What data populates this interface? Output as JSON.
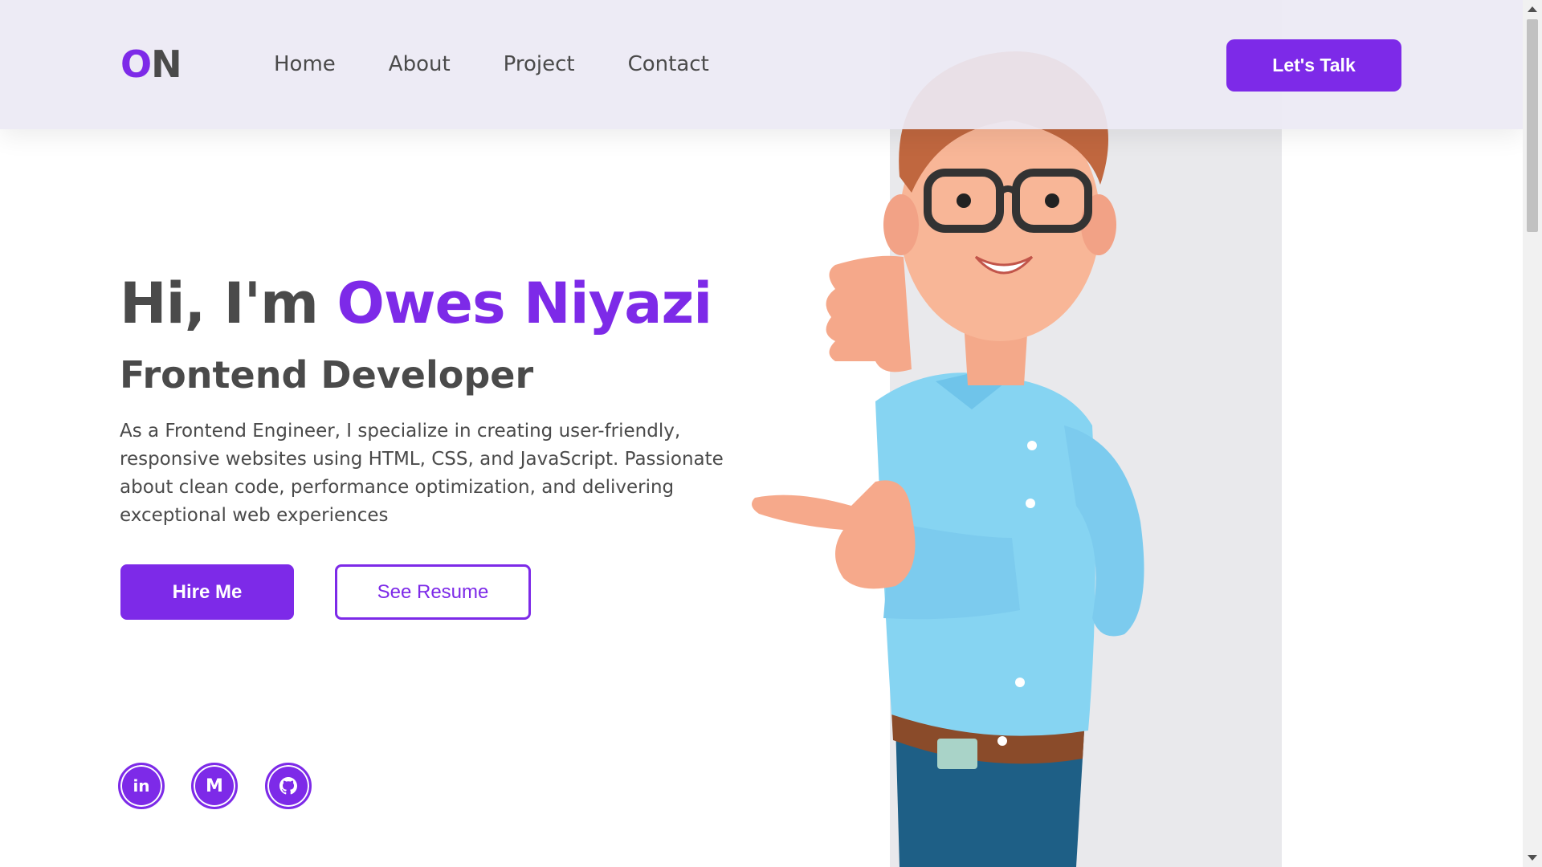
{
  "header": {
    "logo": {
      "first": "O",
      "rest": "N"
    },
    "nav": [
      {
        "label": "Home"
      },
      {
        "label": "About"
      },
      {
        "label": "Project"
      },
      {
        "label": "Contact"
      }
    ],
    "cta_label": "Let's Talk"
  },
  "hero": {
    "greeting": "Hi, I'm",
    "name": "Owes Niyazi",
    "role": "Frontend Developer",
    "description": "As a Frontend Engineer, I specialize in creating user-friendly, responsive websites using HTML, CSS, and JavaScript. Passionate about clean code, performance optimization, and delivering exceptional web experiences",
    "primary_button": "Hire Me",
    "secondary_button": "See Resume"
  },
  "social": [
    {
      "icon": "linkedin-icon",
      "glyph": "in"
    },
    {
      "icon": "medium-icon",
      "glyph": "M"
    },
    {
      "icon": "github-icon",
      "glyph": ""
    }
  ],
  "colors": {
    "accent": "#7d2ae8",
    "text": "#4a4a4a",
    "header_bg": "#eceaf4",
    "panel_bg": "#e9e9ec"
  }
}
